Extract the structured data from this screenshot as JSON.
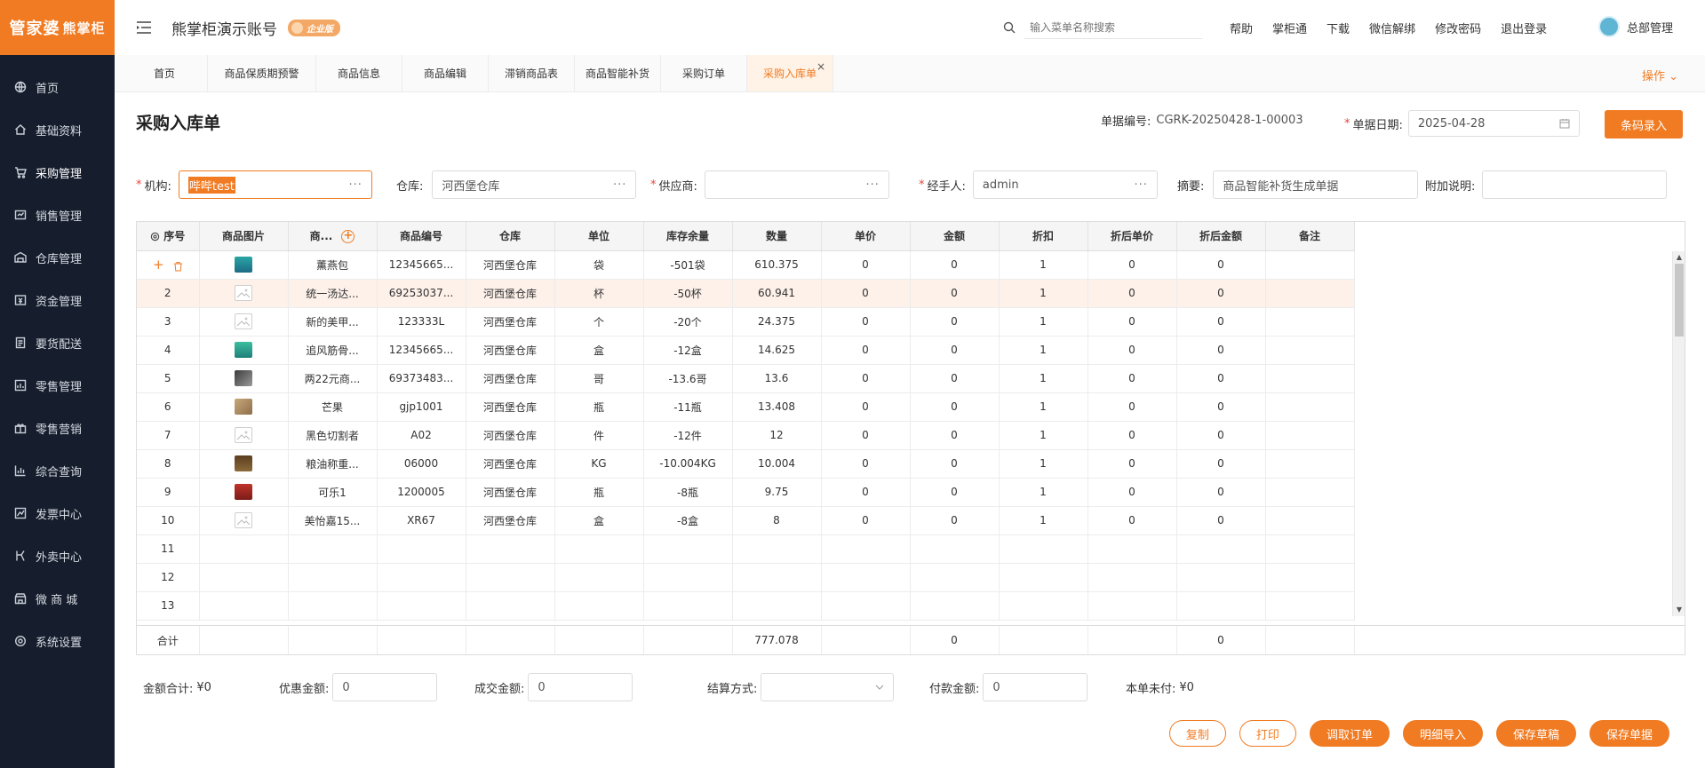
{
  "app": {
    "logo_main": "管家婆",
    "logo_sub": "熊掌柜",
    "account_title": "熊掌柜演示账号",
    "edition_badge": "企业版",
    "search_placeholder": "输入菜单名称搜索",
    "header_links": [
      "帮助",
      "掌柜通",
      "下载",
      "微信解绑",
      "修改密码",
      "退出登录"
    ],
    "user_name": "总部管理",
    "brand_color": "#f07b22"
  },
  "sidebar": {
    "items": [
      {
        "label": "首页",
        "icon": "globe-icon"
      },
      {
        "label": "基础资料",
        "icon": "home-icon"
      },
      {
        "label": "采购管理",
        "icon": "cart-icon"
      },
      {
        "label": "销售管理",
        "icon": "sales-icon"
      },
      {
        "label": "仓库管理",
        "icon": "warehouse-icon"
      },
      {
        "label": "资金管理",
        "icon": "money-icon"
      },
      {
        "label": "要货配送",
        "icon": "document-icon"
      },
      {
        "label": "零售管理",
        "icon": "chart-icon"
      },
      {
        "label": "零售营销",
        "icon": "gift-icon"
      },
      {
        "label": "综合查询",
        "icon": "bar-chart-icon"
      },
      {
        "label": "发票中心",
        "icon": "line-chart-icon"
      },
      {
        "label": "外卖中心",
        "icon": "takeaway-icon"
      },
      {
        "label": "微 商 城",
        "icon": "shop-icon"
      },
      {
        "label": "系统设置",
        "icon": "gear-icon"
      }
    ]
  },
  "tabs": [
    "首页",
    "商品保质期预警",
    "商品信息",
    "商品编辑",
    "滞销商品表",
    "商品智能补货",
    "采购订单",
    "采购入库单"
  ],
  "tab_close": "×",
  "ops_label": "操作",
  "page": {
    "title": "采购入库单",
    "doc_no_label": "单据编号:",
    "doc_no": "CGRK-20250428-1-00003",
    "date_label": "单据日期:",
    "date": "2025-04-28",
    "barcode_btn": "条码录入"
  },
  "form": {
    "org_label": "机构:",
    "org_value": "哔哔test",
    "warehouse_label": "仓库:",
    "warehouse_value": "河西堡仓库",
    "supplier_label": "供应商:",
    "supplier_value": "",
    "handler_label": "经手人:",
    "handler_value": "admin",
    "summary_label": "摘要:",
    "summary_value": "商品智能补货生成单据",
    "note_label": "附加说明:",
    "note_value": "",
    "dots": "···"
  },
  "table": {
    "headers": [
      "序号",
      "商品图片",
      "商...",
      "商品编号",
      "仓库",
      "单位",
      "库存余量",
      "数量",
      "单价",
      "金额",
      "折扣",
      "折后单价",
      "折后金额",
      "备注"
    ],
    "rows": [
      {
        "seq": "",
        "name": "薰燕包",
        "code": "12345665...",
        "wh": "河西堡仓库",
        "unit": "袋",
        "stock": "-501袋",
        "qty": "610.375",
        "price": "0",
        "amount": "0",
        "discount": "1",
        "dprice": "0",
        "damount": "0",
        "img": "thumb-teal"
      },
      {
        "seq": "2",
        "name": "统一汤达...",
        "code": "69253037...",
        "wh": "河西堡仓库",
        "unit": "杯",
        "stock": "-50杯",
        "qty": "60.941",
        "price": "0",
        "amount": "0",
        "discount": "1",
        "dprice": "0",
        "damount": "0",
        "img": "placeholder"
      },
      {
        "seq": "3",
        "name": "新的美甲...",
        "code": "123333L",
        "wh": "河西堡仓库",
        "unit": "个",
        "stock": "-20个",
        "qty": "24.375",
        "price": "0",
        "amount": "0",
        "discount": "1",
        "dprice": "0",
        "damount": "0",
        "img": "placeholder"
      },
      {
        "seq": "4",
        "name": "追风筋骨...",
        "code": "12345665...",
        "wh": "河西堡仓库",
        "unit": "盒",
        "stock": "-12盒",
        "qty": "14.625",
        "price": "0",
        "amount": "0",
        "discount": "1",
        "dprice": "0",
        "damount": "0",
        "img": "thumb-teal2"
      },
      {
        "seq": "5",
        "name": "两22元商...",
        "code": "69373483...",
        "wh": "河西堡仓库",
        "unit": "哥",
        "stock": "-13.6哥",
        "qty": "13.6",
        "price": "0",
        "amount": "0",
        "discount": "1",
        "dprice": "0",
        "damount": "0",
        "img": "thumb-dark"
      },
      {
        "seq": "6",
        "name": "芒果",
        "code": "gjp1001",
        "wh": "河西堡仓库",
        "unit": "瓶",
        "stock": "-11瓶",
        "qty": "13.408",
        "price": "0",
        "amount": "0",
        "discount": "1",
        "dprice": "0",
        "damount": "0",
        "img": "thumb-tan"
      },
      {
        "seq": "7",
        "name": "黑色切割者",
        "code": "A02",
        "wh": "河西堡仓库",
        "unit": "件",
        "stock": "-12件",
        "qty": "12",
        "price": "0",
        "amount": "0",
        "discount": "1",
        "dprice": "0",
        "damount": "0",
        "img": "placeholder"
      },
      {
        "seq": "8",
        "name": "粮油称重...",
        "code": "06000",
        "wh": "河西堡仓库",
        "unit": "KG",
        "stock": "-10.004KG",
        "qty": "10.004",
        "price": "0",
        "amount": "0",
        "discount": "1",
        "dprice": "0",
        "damount": "0",
        "img": "thumb-brown"
      },
      {
        "seq": "9",
        "name": "可乐1",
        "code": "1200005",
        "wh": "河西堡仓库",
        "unit": "瓶",
        "stock": "-8瓶",
        "qty": "9.75",
        "price": "0",
        "amount": "0",
        "discount": "1",
        "dprice": "0",
        "damount": "0",
        "img": "thumb-red"
      },
      {
        "seq": "10",
        "name": "美怡嘉15...",
        "code": "XR67",
        "wh": "河西堡仓库",
        "unit": "盒",
        "stock": "-8盒",
        "qty": "8",
        "price": "0",
        "amount": "0",
        "discount": "1",
        "dprice": "0",
        "damount": "0",
        "img": "placeholder"
      }
    ],
    "empty_rows": [
      "11",
      "12",
      "13"
    ],
    "total_label": "合计",
    "total_qty": "777.078",
    "total_amount": "0",
    "total_damount": "0"
  },
  "footer": {
    "amount_total_label": "金额合计:",
    "amount_total": "¥0",
    "discount_label": "优惠金额:",
    "discount_value": "0",
    "deal_label": "成交金额:",
    "deal_value": "0",
    "settle_label": "结算方式:",
    "settle_value": "",
    "pay_label": "付款金额:",
    "pay_value": "0",
    "unpaid_label": "本单未付:",
    "unpaid": "¥0"
  },
  "actions": {
    "copy": "复制",
    "print": "打印",
    "fetch_order": "调取订单",
    "import_detail": "明细导入",
    "save_draft": "保存草稿",
    "save_doc": "保存单据"
  }
}
